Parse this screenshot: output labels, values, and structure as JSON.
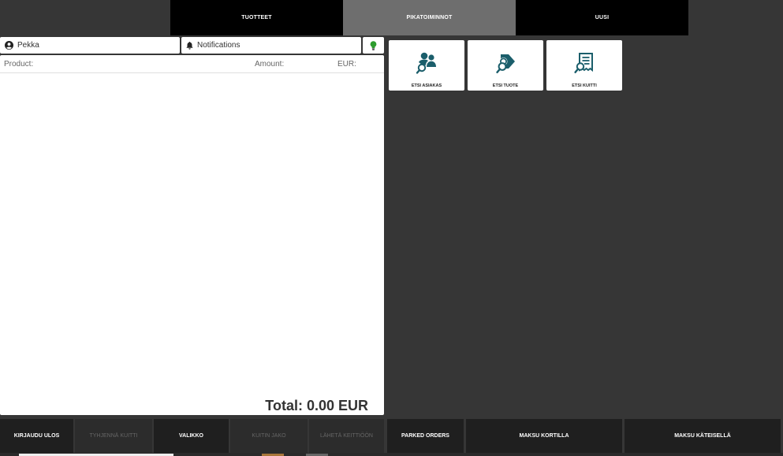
{
  "tabs": [
    {
      "label": "TUOTTEET",
      "active": false
    },
    {
      "label": "PIKATOIMINNOT",
      "active": true
    },
    {
      "label": "UUSI",
      "active": false
    }
  ],
  "header": {
    "user": "Pekka",
    "notifications": "Notifications"
  },
  "receipt": {
    "col_product": "Product:",
    "col_amount": "Amount:",
    "col_eur": "EUR:",
    "total": "Total: 0.00 EUR"
  },
  "quick_actions": [
    {
      "label": "ETSI ASIAKAS",
      "icon": "find-customer-icon"
    },
    {
      "label": "ETSI TUOTE",
      "icon": "find-product-icon"
    },
    {
      "label": "ETSI KUITTI",
      "icon": "find-receipt-icon"
    }
  ],
  "bottom_buttons": [
    {
      "label": "KIRJAUDU ULOS",
      "enabled": true
    },
    {
      "label": "TYHJENNÄ KUITTI",
      "enabled": false
    },
    {
      "label": "VALIKKO",
      "enabled": true
    },
    {
      "label": "KUITIN JAKO",
      "enabled": false
    },
    {
      "label": "LÄHETÄ KEITTIÖÖN",
      "enabled": false
    },
    {
      "label": "PARKED ORDERS",
      "enabled": true
    },
    {
      "label": "MAKSU KORTILLA",
      "enabled": true
    },
    {
      "label": "MAKSU KÄTEISELLÄ",
      "enabled": true
    }
  ],
  "colors": {
    "accent": "#1b5e6b",
    "bulb": "#2e9c2e",
    "background": "#363636"
  }
}
